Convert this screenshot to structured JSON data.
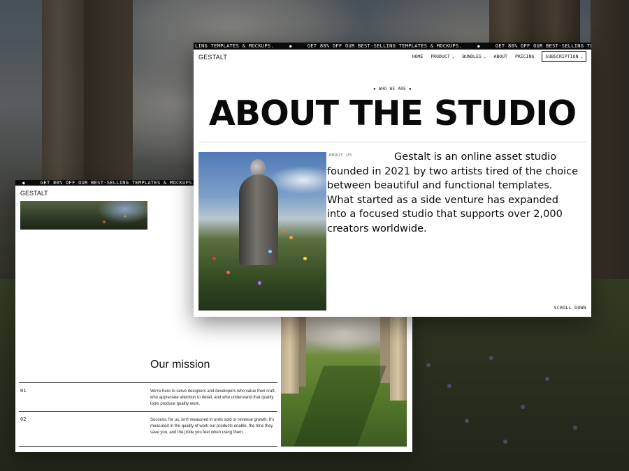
{
  "colors": {
    "ticker_bg": "#0a0a0a",
    "ticker_text": "#f2f2f2",
    "card_bg": "#ffffff",
    "text": "#0a0a0a"
  },
  "ticker": {
    "message": "GET 80% OFF OUR BEST-SELLING TEMPLATES & MOCKUPS.",
    "front_start": "LING TEMPLATES & MOCKUPS.",
    "front_end": "GET 80% OFF OUR BEST-SELLING TEMPLATES &"
  },
  "front": {
    "brand": "GESTALT",
    "nav": {
      "home": "HOME",
      "product": "PRODUCT",
      "bundles": "BUNDLES",
      "about": "ABOUT",
      "pricing": "PRICING",
      "subscription": "SUBSCRIPTION"
    },
    "kicker": "▪ WHO WE ARE ▪",
    "hero_title": "ABOUT THE STUDIO",
    "about_label": "ABOUT US",
    "about_text": "Gestalt is an online asset studio founded in 2021 by two artists tired of the choice between beautiful and functional templates. What started as a side venture has expanded into a focused studio that supports over 2,000 creators worldwide.",
    "scroll_label": "SCROLL DOWN"
  },
  "back": {
    "brand": "GESTALT",
    "mission_title": "Our mission",
    "items": [
      {
        "number": "01",
        "text": "We're here to serve designers and developers who value their craft, who appreciate attention to detail, and who understand that quality tools produce quality work."
      },
      {
        "number": "02",
        "text": "Success, for us, isn't measured in units sold or revenue growth. It's measured in the quality of work our products enable, the time they save you, and the pride you feel when using them."
      }
    ]
  }
}
